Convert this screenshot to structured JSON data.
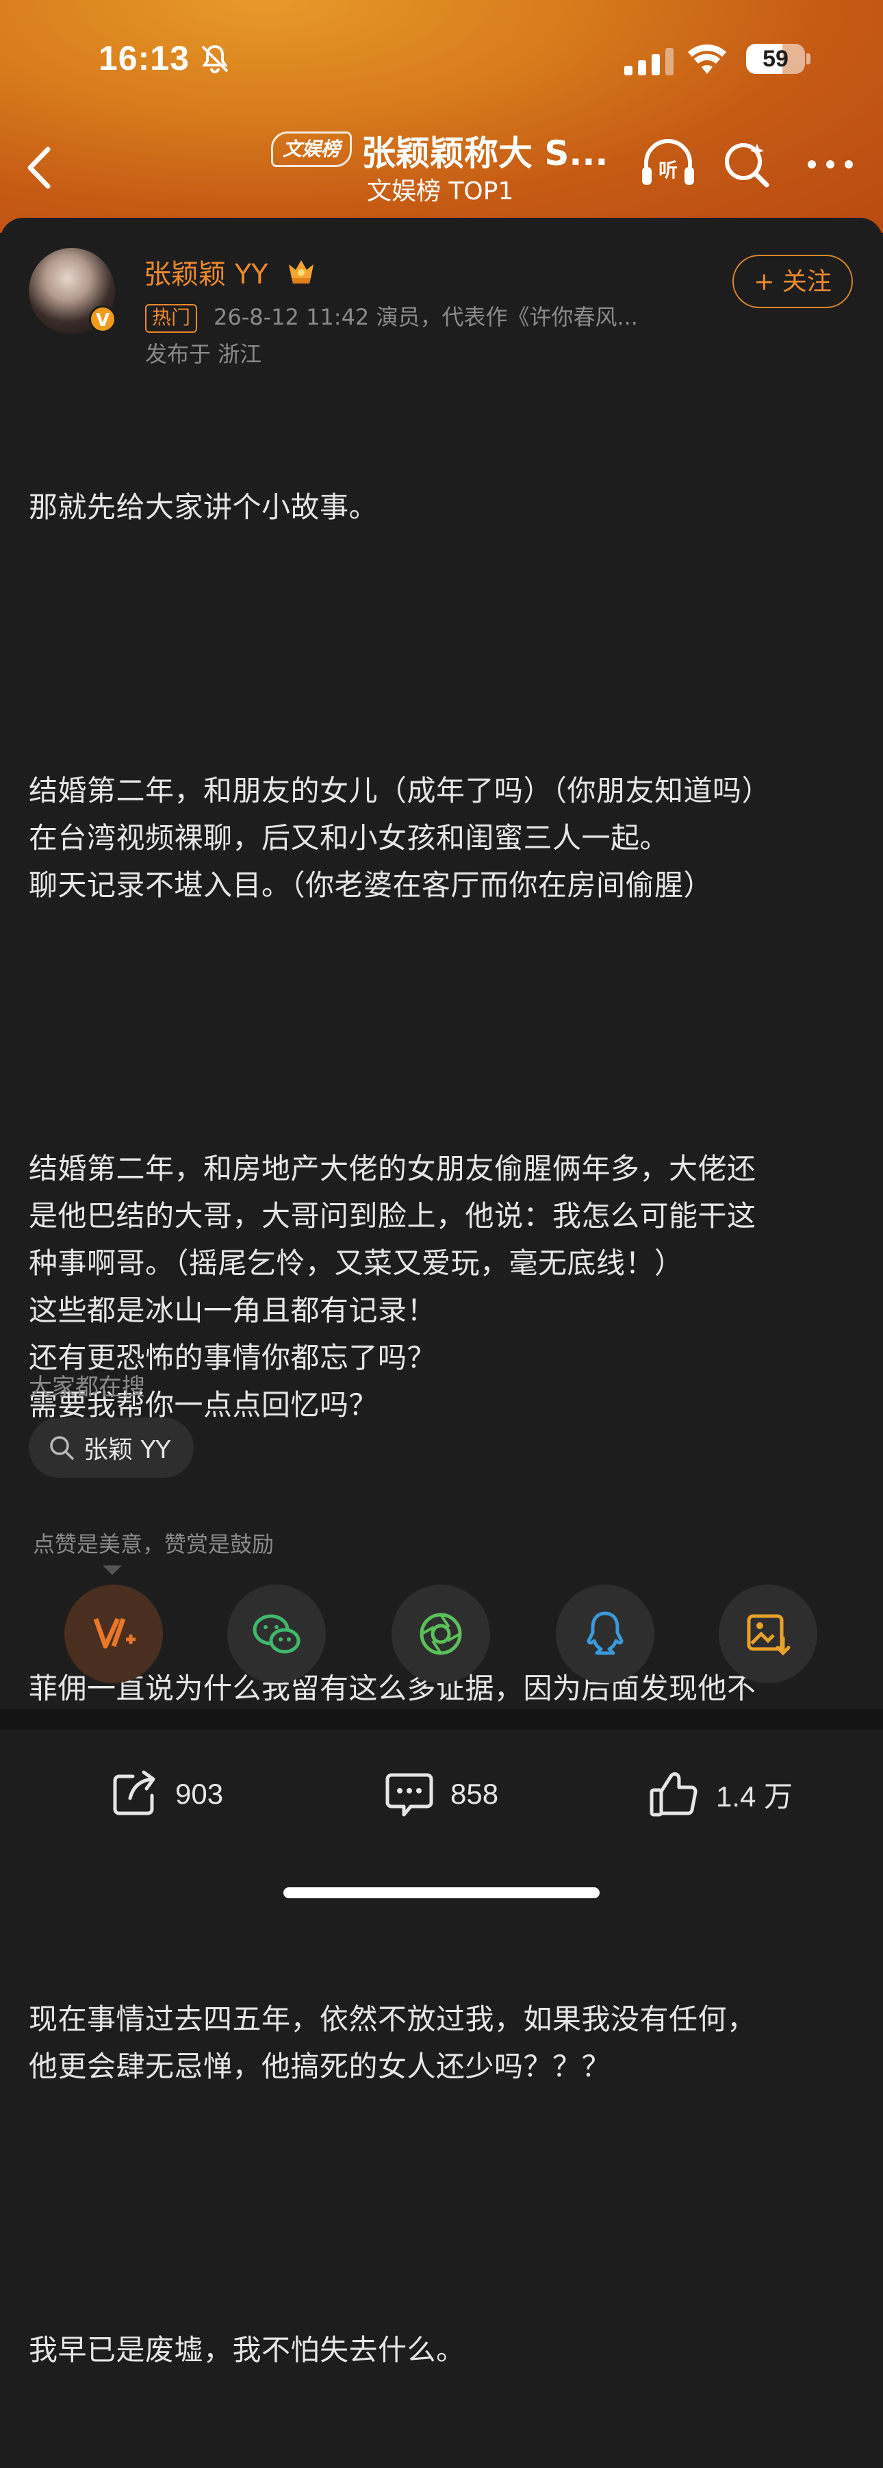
{
  "status_bar": {
    "time": "16:13",
    "battery": "59"
  },
  "nav": {
    "badge": "文娱榜",
    "title": "张颖颖称大 S...",
    "subtitle": "文娱榜 TOP1"
  },
  "author": {
    "name": "张颖颖 YY",
    "follow_label": "+ 关注",
    "hot_tag": "热门",
    "meta": "26-8-12 11:42  演员，代表作《许你春风...",
    "location": "发布于 浙江",
    "verified_mark": "V"
  },
  "post_paragraphs": [
    "那就先给大家讲个小故事。",
    "",
    "结婚第二年，和朋友的女儿（成年了吗）（你朋友知道吗）\n在台湾视频裸聊，后又和小女孩和闺蜜三人一起。\n聊天记录不堪入目。（你老婆在客厅而你在房间偷腥）",
    "",
    "结婚第二年，和房地产大佬的女朋友偷腥俩年多，大佬还\n是他巴结的大哥，大哥问到脸上，他说：我怎么可能干这\n种事啊哥。（摇尾乞怜，又菜又爱玩，毫无底线！）\n这些都是冰山一角且都有记录！\n还有更恐怖的事情你都忘了吗？\n需要我帮你一点点回忆吗？",
    "",
    "菲佣一直说为什么我留有这么多证据，因为后面发现他不\n是人！是鬼！来索命的！我是保命才留下。",
    "",
    "现在事情过去四五年，依然不放过我，如果我没有任何，\n他更会肆无忌惮，他搞死的女人还少吗？？？",
    "",
    "我早已是废墟，我不怕失去什么。"
  ],
  "searching": {
    "label": "大家都在搜",
    "chip": "张颖 YY"
  },
  "reward_tip": "点赞是美意，赞赏是鼓励",
  "share_buttons": [
    "reward-icon",
    "wechat-icon",
    "moments-icon",
    "qq-icon",
    "save-image-icon"
  ],
  "actions": {
    "repost": "903",
    "comment": "858",
    "like": "1.4 万"
  },
  "colors": {
    "accent": "#ee8a2c",
    "background": "#1d1d1d",
    "header": "#d77b1c"
  }
}
